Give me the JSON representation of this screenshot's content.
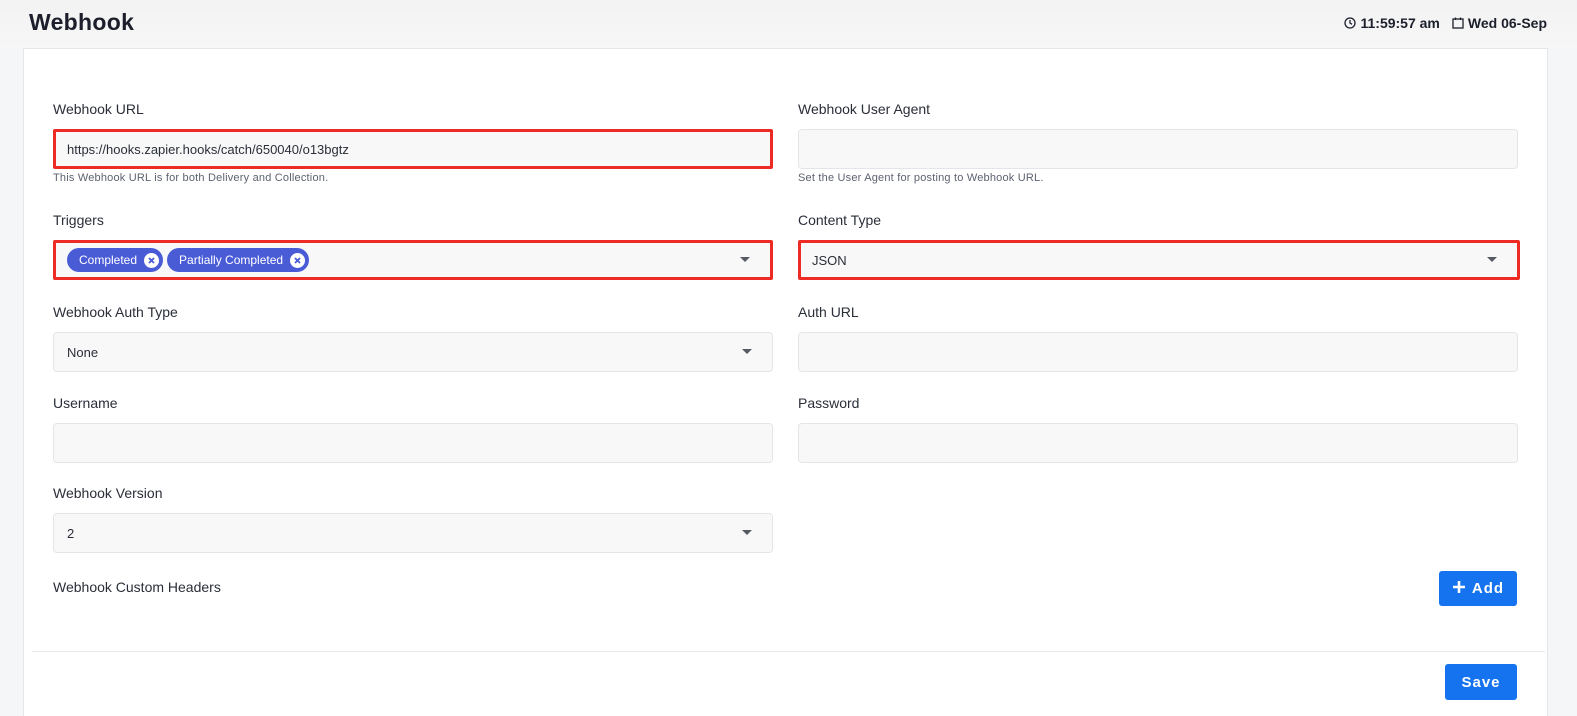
{
  "header": {
    "title": "Webhook",
    "time": "11:59:57 am",
    "date": "Wed 06-Sep",
    "time_icon": "clock-icon",
    "date_icon": "calendar-icon"
  },
  "form": {
    "webhook_url": {
      "label": "Webhook URL",
      "value": "https://hooks.zapier.hooks/catch/650040/o13bgtz",
      "help": "This Webhook URL is for both Delivery and Collection."
    },
    "user_agent": {
      "label": "Webhook User Agent",
      "value": "",
      "help": "Set the User Agent for posting to Webhook URL."
    },
    "triggers": {
      "label": "Triggers",
      "chips": [
        "Completed",
        "Partially Completed"
      ]
    },
    "content_type": {
      "label": "Content Type",
      "value": "JSON"
    },
    "auth_type": {
      "label": "Webhook Auth Type",
      "value": "None"
    },
    "auth_url": {
      "label": "Auth URL",
      "value": ""
    },
    "username": {
      "label": "Username",
      "value": ""
    },
    "password": {
      "label": "Password",
      "value": ""
    },
    "version": {
      "label": "Webhook Version",
      "value": "2"
    },
    "custom_headers": {
      "label": "Webhook Custom Headers",
      "add_label": "Add"
    }
  },
  "footer": {
    "save_label": "Save"
  },
  "colors": {
    "accent": "#1673f0",
    "chip": "#4a5bd6",
    "highlight": "#ee2a24"
  }
}
